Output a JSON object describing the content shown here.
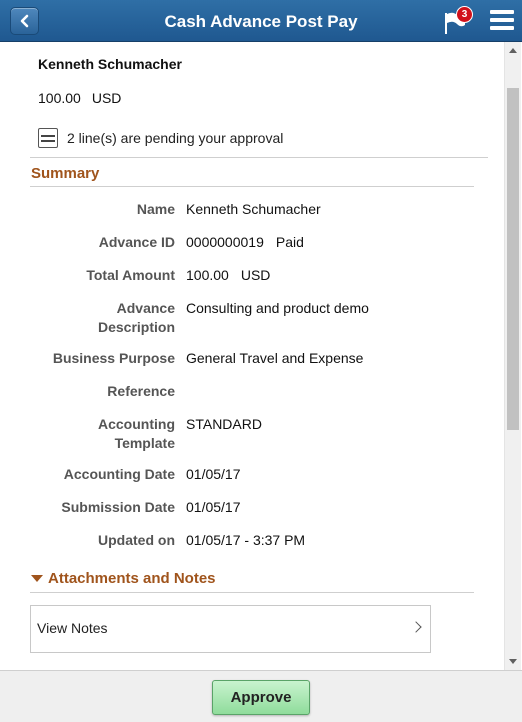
{
  "header": {
    "title": "Cash Advance Post Pay",
    "notification_count": "3"
  },
  "requester": {
    "name": "Kenneth Schumacher",
    "amount": "100.00",
    "currency": "USD"
  },
  "pending": {
    "text": "2 line(s) are pending your approval"
  },
  "summary": {
    "title": "Summary",
    "rows": [
      {
        "label": "Name",
        "value": "Kenneth Schumacher"
      },
      {
        "label": "Advance ID",
        "value": "0000000019",
        "extra": "Paid"
      },
      {
        "label": "Total Amount",
        "value": "100.00",
        "extra": "USD"
      },
      {
        "label_line1": "Advance",
        "label_line2": "Description",
        "value": "Consulting and product demo"
      },
      {
        "label": "Business Purpose",
        "value": "General Travel and Expense"
      },
      {
        "label": "Reference",
        "value": ""
      },
      {
        "label_line1": "Accounting",
        "label_line2": "Template",
        "value": "STANDARD"
      },
      {
        "label": "Accounting Date",
        "value": "01/05/17"
      },
      {
        "label": "Submission Date",
        "value": "01/05/17"
      },
      {
        "label": "Updated on",
        "value": "01/05/17 - 3:37 PM"
      }
    ]
  },
  "attachments": {
    "title": "Attachments and Notes",
    "view_notes_label": "View Notes"
  },
  "footer": {
    "approve_label": "Approve"
  },
  "colors": {
    "header_blue": "#2a659c",
    "section_accent": "#a0541c",
    "approve_green": "#8fdc9b",
    "badge_red": "#d1111b"
  }
}
